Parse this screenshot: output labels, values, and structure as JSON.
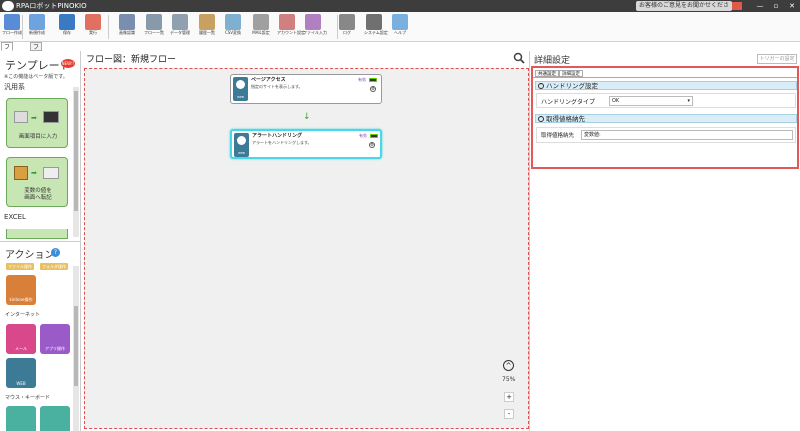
{
  "app": {
    "title": "RPAロボットPINOKIO",
    "feedback": "お客様のご意見をお聞かせください",
    "win_min": "—",
    "win_max": "▫",
    "win_close": "✕"
  },
  "ribbon": [
    {
      "label": "フロー作成",
      "color": "#5a8bd6"
    },
    {
      "label": "新規作成",
      "color": "#6fa3e0"
    },
    {
      "label": "保存",
      "color": "#3a7ac2"
    },
    {
      "label": "実行",
      "color": "#e07060"
    },
    {
      "label": "画像認識",
      "color": "#7a8fb0"
    },
    {
      "label": "フロー一覧",
      "color": "#8899aa"
    },
    {
      "label": "データ管理",
      "color": "#90a0b0"
    },
    {
      "label": "履歴一覧",
      "color": "#c8a060"
    },
    {
      "label": "CSV変換",
      "color": "#80b0d0"
    },
    {
      "label": "MAIL設定",
      "color": "#a0a0a0"
    },
    {
      "label": "アカウント設定",
      "color": "#d08080"
    },
    {
      "label": "ファイル入力",
      "color": "#b080c0"
    },
    {
      "label": "ログ",
      "color": "#888888"
    },
    {
      "label": "システム設定",
      "color": "#707070"
    },
    {
      "label": "ヘルプ",
      "color": "#7ab0e0"
    }
  ],
  "tabs": [
    {
      "label": "フロー作成"
    },
    {
      "label": "フロー設定"
    }
  ],
  "left": {
    "template_title": "テンプレート",
    "new_badge": "NEW!!",
    "beta_note": "※この機能はベータ版です。",
    "cat_general": "汎用系",
    "card1": "画面項目に入力",
    "card2a": "変数の値を",
    "card2b": "画面へ転記",
    "cat_excel": "EXCEL",
    "action_title": "アクション",
    "help_mark": "?",
    "btn_file": "ファイル操作",
    "btn_folder": "フォルダ操作",
    "kintone": "kintone操作",
    "cat_internet": "インターネット",
    "mail": "メール",
    "app_op": "アプリ操作",
    "web": "WEB",
    "cat_mouse": "マウス・キーボード"
  },
  "canvas": {
    "title": "フロー図：新規フロー",
    "node1": {
      "title": "ページアクセス",
      "desc": "指定のサイトを表示します。",
      "enabled": "有効",
      "icon": "WEB"
    },
    "node2": {
      "title": "アラートハンドリング",
      "desc": "アラートをハンドリングします。",
      "enabled": "有効",
      "icon": "WEB"
    },
    "zoom": "75%",
    "zoom_in": "+",
    "zoom_out": "-",
    "up": "^"
  },
  "right": {
    "title": "詳細設定",
    "trigger": "トリガーの設定",
    "tab_common": "共通設定",
    "tab_detail": "詳細設定",
    "sec1": "ハンドリング設定",
    "handling_type_label": "ハンドリングタイプ",
    "handling_type_value": "OK",
    "sec2": "取得値格納先",
    "store_label": "取得値格納先",
    "store_value": "変数値:"
  }
}
